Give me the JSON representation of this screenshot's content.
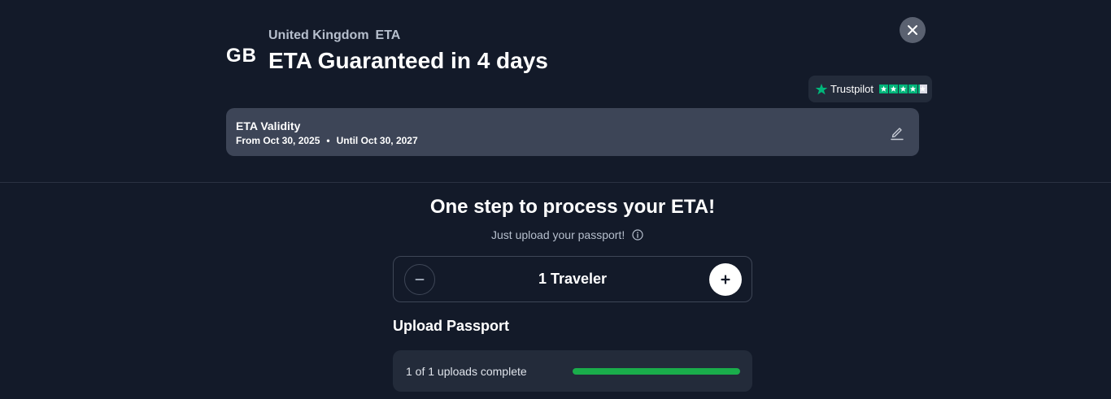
{
  "header": {
    "country_code": "GB",
    "country_name": "United Kingdom",
    "product": "ETA",
    "headline": "ETA Guaranteed in 4 days"
  },
  "trustpilot": {
    "label": "Trustpilot",
    "rating_stars": 4.2,
    "star_color": "#00b67a"
  },
  "validity": {
    "title": "ETA Validity",
    "from": "From Oct 30, 2025",
    "separator": "•",
    "until": "Until Oct 30, 2027"
  },
  "step": {
    "title": "One step to process your ETA!",
    "subtitle": "Just upload your passport!",
    "info_icon": "info-icon"
  },
  "travelers": {
    "count_label": "1 Traveler",
    "minus_icon": "minus-icon",
    "plus_icon": "plus-icon"
  },
  "upload": {
    "title": "Upload Passport",
    "status": "1 of 1 uploads complete",
    "progress_fraction": 1.0,
    "progress_color": "#1aad4b"
  },
  "icons": {
    "close": "close-icon",
    "edit": "pencil-icon"
  }
}
